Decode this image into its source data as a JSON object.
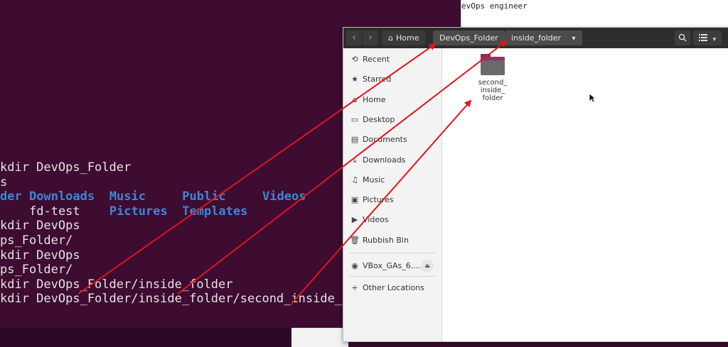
{
  "terminal": {
    "lines": [
      {
        "segments": [
          {
            "text": "kdir DevOps_Folder",
            "color": "normal",
            "col": 0
          }
        ]
      },
      {
        "segments": [
          {
            "text": "s",
            "color": "normal",
            "col": 0
          }
        ]
      },
      {
        "segments": [
          {
            "text": "der",
            "color": "blue",
            "col": 0
          },
          {
            "text": "Downloads",
            "color": "blue",
            "col": 4
          },
          {
            "text": "Music",
            "color": "blue",
            "col": 15
          },
          {
            "text": "Public",
            "color": "blue",
            "col": 25
          },
          {
            "text": "Videos",
            "color": "blue",
            "col": 36
          }
        ]
      },
      {
        "segments": [
          {
            "text": "fd-test",
            "color": "normal",
            "col": 4
          },
          {
            "text": "Pictures",
            "color": "blue",
            "col": 15
          },
          {
            "text": "Templates",
            "color": "blue",
            "col": 25
          }
        ]
      },
      {
        "segments": [
          {
            "text": "kdir DevOps",
            "color": "normal",
            "col": 0
          }
        ]
      },
      {
        "segments": [
          {
            "text": "ps_Folder/",
            "color": "normal",
            "col": 0
          }
        ]
      },
      {
        "segments": [
          {
            "text": "kdir DevOps",
            "color": "normal",
            "col": 0
          }
        ]
      },
      {
        "segments": [
          {
            "text": "ps_Folder/",
            "color": "normal",
            "col": 0
          }
        ]
      },
      {
        "segments": [
          {
            "text": "kdir DevOps_Folder/inside_folder",
            "color": "normal",
            "col": 0
          }
        ]
      },
      {
        "segments": [
          {
            "text": "kdir DevOps_Folder/inside_folder/second_inside_",
            "color": "normal",
            "col": 0
          }
        ]
      }
    ]
  },
  "editor": {
    "text": "evOps engineer"
  },
  "file_manager": {
    "nav": {
      "back": "‹",
      "forward": "›"
    },
    "breadcrumb": [
      {
        "label": "Home",
        "icon": "home-icon"
      },
      {
        "label": "DevOps_Folder"
      },
      {
        "label": "inside_folder",
        "dropdown": "▾"
      }
    ],
    "header_buttons": {
      "search": "search-icon",
      "view": "list-view-icon",
      "view_dropdown": "▾"
    },
    "sidebar": {
      "items": [
        {
          "label": "Recent",
          "icon": "clock-icon",
          "glyph": "⟲"
        },
        {
          "label": "Starred",
          "icon": "star-icon",
          "glyph": "★"
        },
        {
          "label": "Home",
          "icon": "home-icon",
          "glyph": "⌂"
        },
        {
          "label": "Desktop",
          "icon": "desktop-icon",
          "glyph": "▭"
        },
        {
          "label": "Documents",
          "icon": "document-icon",
          "glyph": "▤"
        },
        {
          "label": "Downloads",
          "icon": "download-icon",
          "glyph": "⤓"
        },
        {
          "label": "Music",
          "icon": "music-icon",
          "glyph": "♫"
        },
        {
          "label": "Pictures",
          "icon": "picture-icon",
          "glyph": "▣"
        },
        {
          "label": "Videos",
          "icon": "video-icon",
          "glyph": "▶"
        },
        {
          "label": "Rubbish Bin",
          "icon": "trash-icon",
          "glyph": "🗑"
        }
      ],
      "devices": [
        {
          "label": "VBox_GAs_6....",
          "icon": "disc-icon",
          "glyph": "◉",
          "eject": "⏏"
        }
      ],
      "other": {
        "label": "Other Locations",
        "glyph": "+"
      }
    },
    "content": {
      "items": [
        {
          "name_lines": [
            "second_",
            "inside_",
            "folder"
          ]
        }
      ]
    }
  },
  "annotation_color": "#e0141e"
}
